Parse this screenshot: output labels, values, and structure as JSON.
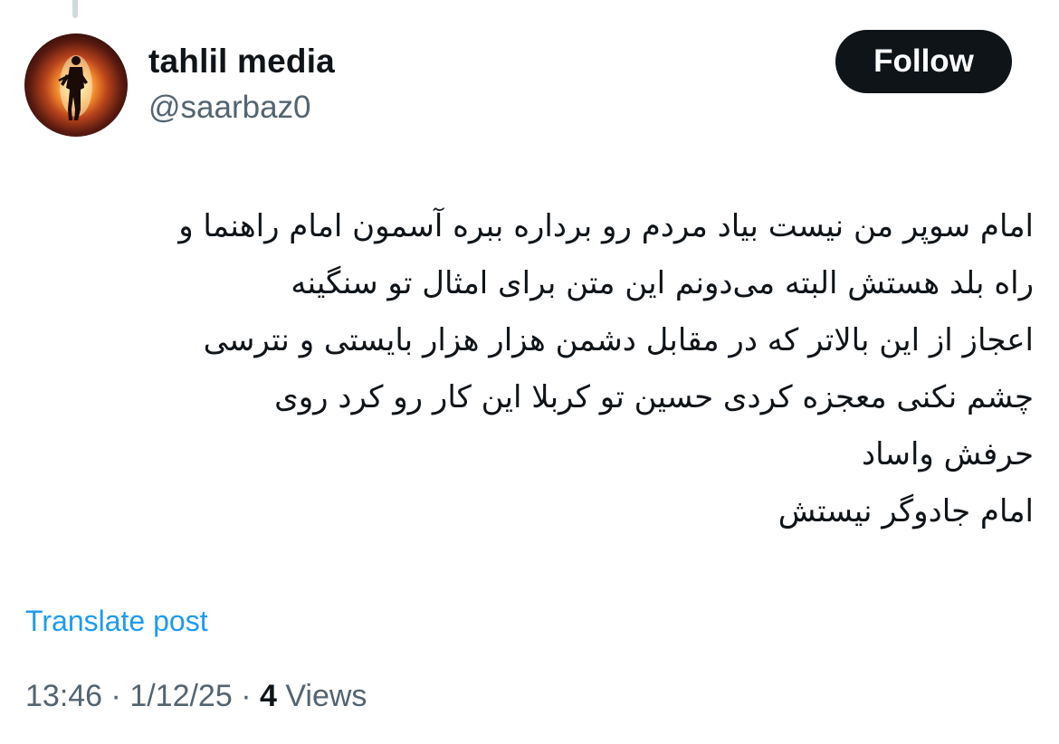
{
  "user": {
    "display_name": "tahlil media",
    "handle": "@saarbaz0"
  },
  "follow_button": {
    "label": "Follow"
  },
  "post": {
    "lines": [
      "امام سوپر من نیست بیاد مردم رو برداره ببره آسمون امام راهنما و",
      "راه بلد هستش البته می‌دونم این متن برای امثال تو سنگینه",
      "اعجاز از این بالاتر که در مقابل دشمن هزار هزار بایستی و نترسی",
      "چشم نکنی معجزه کردی حسین تو کربلا این کار رو کرد روی",
      "حرفش واساد",
      "امام جادوگر نیستش"
    ]
  },
  "translate": {
    "label": "Translate post"
  },
  "meta": {
    "time": "13:46",
    "separator": " · ",
    "date": "1/12/25",
    "views_count": "4",
    "views_label": " Views"
  },
  "colors": {
    "text": "#0f1419",
    "secondary": "#536471",
    "link": "#1d9bf0",
    "button_bg": "#0f1419"
  }
}
